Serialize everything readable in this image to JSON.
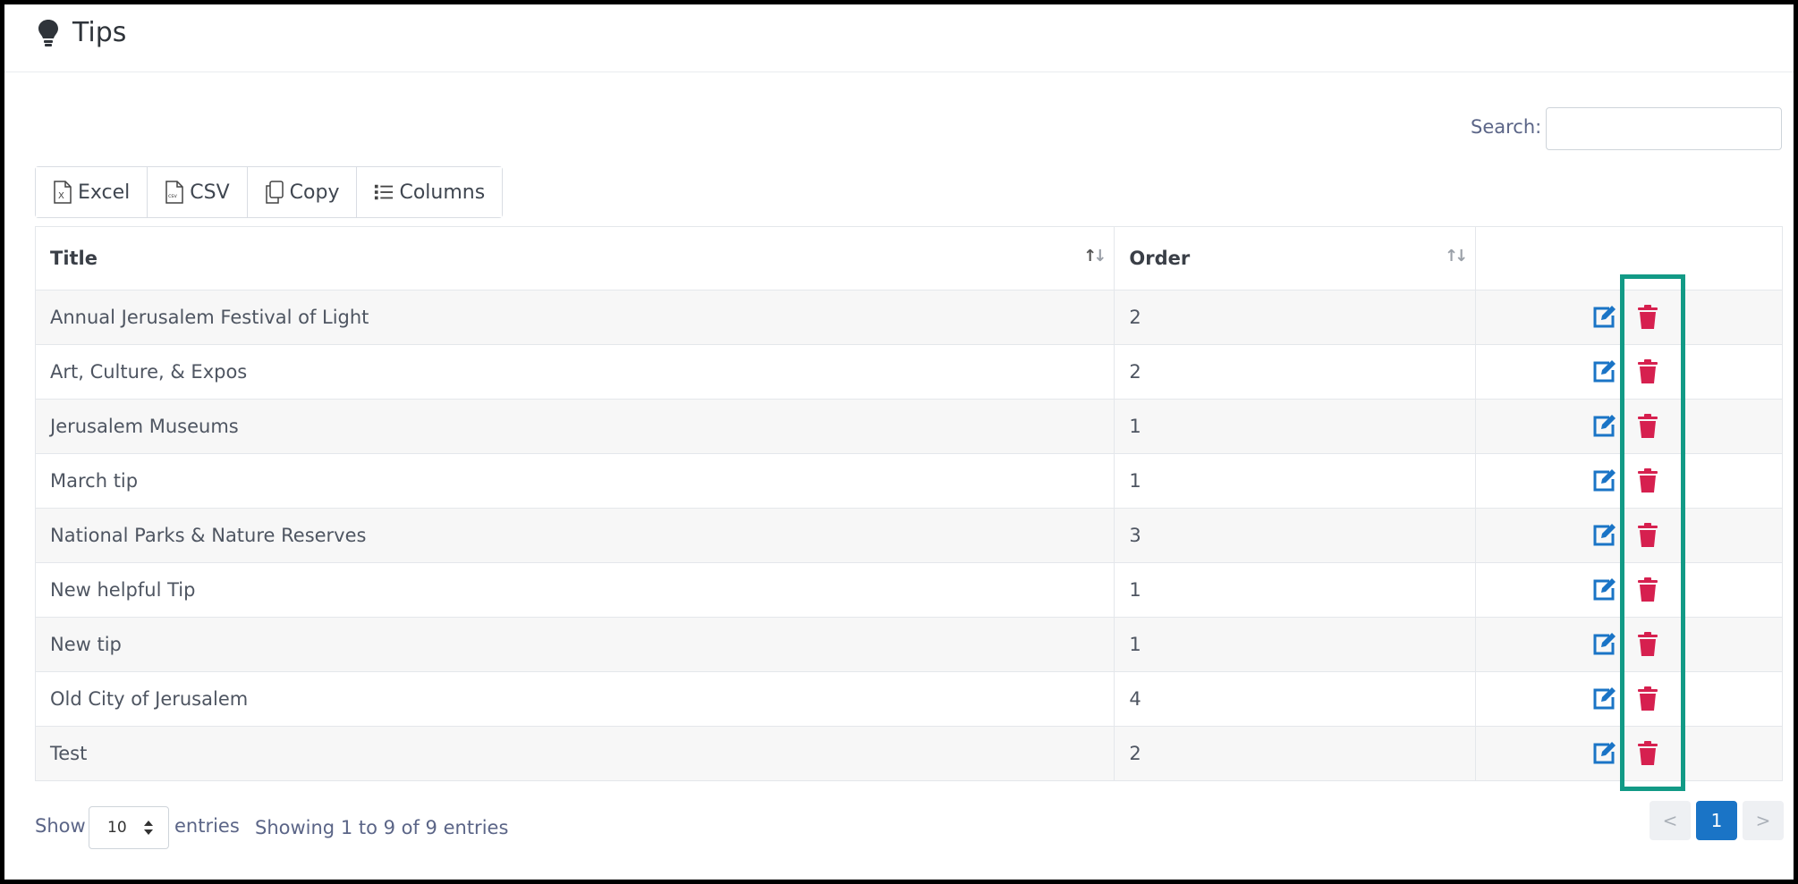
{
  "header": {
    "title": "Tips",
    "icon": "lightbulb-icon"
  },
  "search": {
    "label": "Search:",
    "value": "",
    "placeholder": ""
  },
  "toolbar": {
    "buttons": [
      {
        "label": "Excel",
        "icon": "excel-file-icon"
      },
      {
        "label": "CSV",
        "icon": "csv-file-icon"
      },
      {
        "label": "Copy",
        "icon": "copy-icon"
      },
      {
        "label": "Columns",
        "icon": "list-icon"
      }
    ]
  },
  "table": {
    "columns": [
      "Title",
      "Order",
      ""
    ],
    "rows": [
      {
        "title": "Annual Jerusalem Festival of Light",
        "order": "2"
      },
      {
        "title": "Art, Culture, & Expos",
        "order": "2"
      },
      {
        "title": "Jerusalem Museums",
        "order": "1"
      },
      {
        "title": "March tip",
        "order": "1"
      },
      {
        "title": "National Parks & Nature Reserves",
        "order": "3"
      },
      {
        "title": "New helpful Tip",
        "order": "1"
      },
      {
        "title": "New tip",
        "order": "1"
      },
      {
        "title": "Old City of Jerusalem",
        "order": "4"
      },
      {
        "title": "Test",
        "order": "2"
      }
    ]
  },
  "footer": {
    "show_label": "Show",
    "entries_value": "10",
    "entries_label": "entries",
    "info": "Showing 1 to 9 of 9 entries"
  },
  "pagination": {
    "prev": "<",
    "current": "1",
    "next": ">"
  },
  "colors": {
    "accent": "#1a74c6",
    "delete": "#d6204f",
    "highlight": "#129a86"
  }
}
